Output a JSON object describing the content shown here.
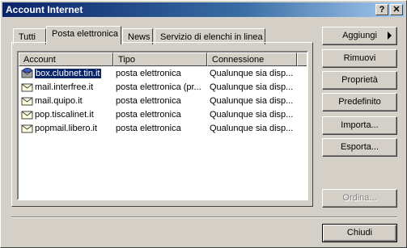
{
  "window": {
    "title": "Account Internet",
    "help_label": "?",
    "close_label": "✕"
  },
  "tabs": [
    {
      "label": "Tutti"
    },
    {
      "label": "Posta elettronica"
    },
    {
      "label": "News"
    },
    {
      "label": "Servizio di elenchi in linea"
    }
  ],
  "active_tab": "Posta elettronica",
  "list": {
    "columns": [
      "Account",
      "Tipo",
      "Connessione"
    ],
    "rows": [
      {
        "account": "box.clubnet.tin.it",
        "tipo": "posta elettronica",
        "connessione": "Qualunque sia disp...",
        "selected": true,
        "icon": "mail-account-default-icon"
      },
      {
        "account": "mail.interfree.it",
        "tipo": "posta elettronica (pr...",
        "connessione": "Qualunque sia disp...",
        "icon": "mail-account-icon"
      },
      {
        "account": "mail.quipo.it",
        "tipo": "posta elettronica",
        "connessione": "Qualunque sia disp...",
        "icon": "mail-account-icon"
      },
      {
        "account": "pop.tiscalinet.it",
        "tipo": "posta elettronica",
        "connessione": "Qualunque sia disp...",
        "icon": "mail-account-icon"
      },
      {
        "account": "popmail.libero.it",
        "tipo": "posta elettronica",
        "connessione": "Qualunque sia disp...",
        "icon": "mail-account-icon"
      }
    ]
  },
  "buttons": {
    "aggiungi": "Aggiungi",
    "rimuovi": "Rimuovi",
    "proprieta": "Proprietà",
    "predefinito": "Predefinito",
    "importa": "Importa...",
    "esporta": "Esporta...",
    "ordina": "Ordina...",
    "chiudi": "Chiudi"
  },
  "colors": {
    "titlebar": "#0a246a",
    "selection": "#0a246a",
    "face": "#d4d0c8"
  }
}
